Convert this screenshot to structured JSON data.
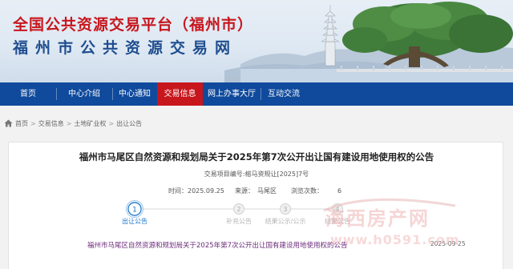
{
  "header": {
    "title_cn": "全国公共资源交易平台（福州市）",
    "subtitle_cn": "福州市公共资源交易网",
    "colors": {
      "title": "#c8161d",
      "subtitle": "#1f4e8f"
    }
  },
  "nav": {
    "items": [
      {
        "label": "首页"
      },
      {
        "label": "中心介绍"
      },
      {
        "label": "中心通知"
      },
      {
        "label": "交易信息"
      },
      {
        "label": "网上办事大厅"
      },
      {
        "label": "互动交流"
      }
    ],
    "active_index": 3,
    "colors": {
      "bar": "#0f4a9c",
      "active": "#c8161d"
    }
  },
  "breadcrumb": {
    "icon": "home-icon",
    "items": [
      "首页",
      "交易信息",
      "土地矿业权",
      "出让公告"
    ]
  },
  "article": {
    "title": "福州市马尾区自然资源和规划局关于2025年第7次公开出让国有建设用地使用权的公告",
    "code": "交易项目编号:榕马资规让[2025]7号",
    "meta": {
      "time_label": "时间：",
      "time_value": "2025.09.25",
      "source_label": "来源：",
      "source_value": "马尾区",
      "views_label": "浏览次数：",
      "views_value": "6"
    }
  },
  "steps": [
    {
      "number": "1",
      "label": "出让公告",
      "active": true
    },
    {
      "number": "2",
      "label": "补充公告",
      "active": false
    },
    {
      "number": "3",
      "label": "结果公示/公示",
      "active": false
    },
    {
      "number": "4",
      "label": "结果公告",
      "active": false
    }
  ],
  "notices": [
    {
      "title": "福州市马尾区自然资源和规划局关于2025年第7次公开出让国有建设用地使用权的公告",
      "date": "2025-09-25"
    }
  ],
  "watermark": {
    "line1": "海西房产网",
    "line2": "www.h0591.com"
  }
}
